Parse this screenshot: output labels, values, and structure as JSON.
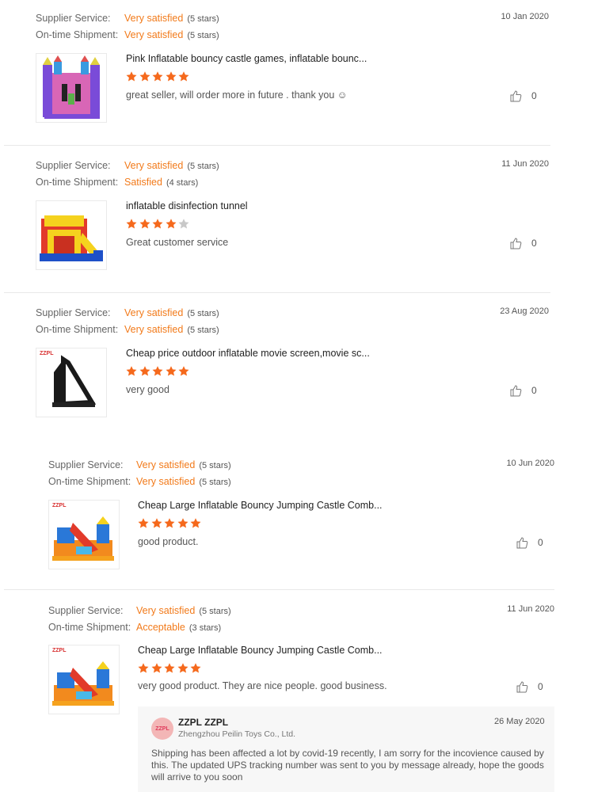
{
  "labels": {
    "supplier_service": "Supplier Service:",
    "ontime_shipment": "On-time Shipment:"
  },
  "colors": {
    "accent_orange": "#f27a1a",
    "star_filled": "#f5691c",
    "star_empty": "#c8c8c8"
  },
  "reviews": [
    {
      "supplier_value": "Very satisfied",
      "supplier_count": "(5 stars)",
      "shipment_value": "Very satisfied",
      "shipment_count": "(5 stars)",
      "date": "10 Jan 2020",
      "product_title": "Pink Inflatable bouncy castle games, inflatable bounc...",
      "rating": 5,
      "comment": "great seller, will order more in future . thank you ☺",
      "likes": "0",
      "thumbnail": "pink-bouncy-castle"
    },
    {
      "supplier_value": "Very satisfied",
      "supplier_count": "(5 stars)",
      "shipment_value": "Satisfied",
      "shipment_count": "(4 stars)",
      "date": "11 Jun 2020",
      "product_title": "inflatable disinfection tunnel",
      "rating": 4,
      "comment": "Great customer service",
      "likes": "0",
      "thumbnail": "inflatable-tunnel"
    },
    {
      "supplier_value": "Very satisfied",
      "supplier_count": "(5 stars)",
      "shipment_value": "Very satisfied",
      "shipment_count": "(5 stars)",
      "date": "23 Aug 2020",
      "product_title": "Cheap price outdoor inflatable movie screen,movie sc...",
      "rating": 5,
      "comment": "very good",
      "likes": "0",
      "thumbnail": "movie-screen",
      "thumb_brand": "ZZPL"
    },
    {
      "supplier_value": "Very satisfied",
      "supplier_count": "(5 stars)",
      "shipment_value": "Very satisfied",
      "shipment_count": "(5 stars)",
      "date": "10 Jun 2020",
      "product_title": "Cheap Large Inflatable Bouncy Jumping Castle Comb...",
      "rating": 5,
      "comment": "good product.",
      "likes": "0",
      "thumbnail": "castle-combo",
      "thumb_brand": "ZZPL"
    },
    {
      "supplier_value": "Very satisfied",
      "supplier_count": "(5 stars)",
      "shipment_value": "Acceptable",
      "shipment_count": "(3 stars)",
      "date": "11 Jun 2020",
      "product_title": "Cheap Large Inflatable Bouncy Jumping Castle Comb...",
      "rating": 5,
      "comment": "very good product. They are nice people. good business.",
      "likes": "0",
      "thumbnail": "castle-combo",
      "thumb_brand": "ZZPL",
      "reply": {
        "name": "ZZPL ZZPL",
        "company": "Zhengzhou Peilin Toys Co., Ltd.",
        "date": "26 May 2020",
        "avatar_text": "ZZPL",
        "text_line1": "Shipping has been affected a lot by covid-19 recently,  I am sorry for the incovience caused by",
        "text_line2": "this. The updated UPS tracking number was sent to you by message already, hope the goods",
        "text_line3": "will arrive to you soon"
      }
    }
  ]
}
